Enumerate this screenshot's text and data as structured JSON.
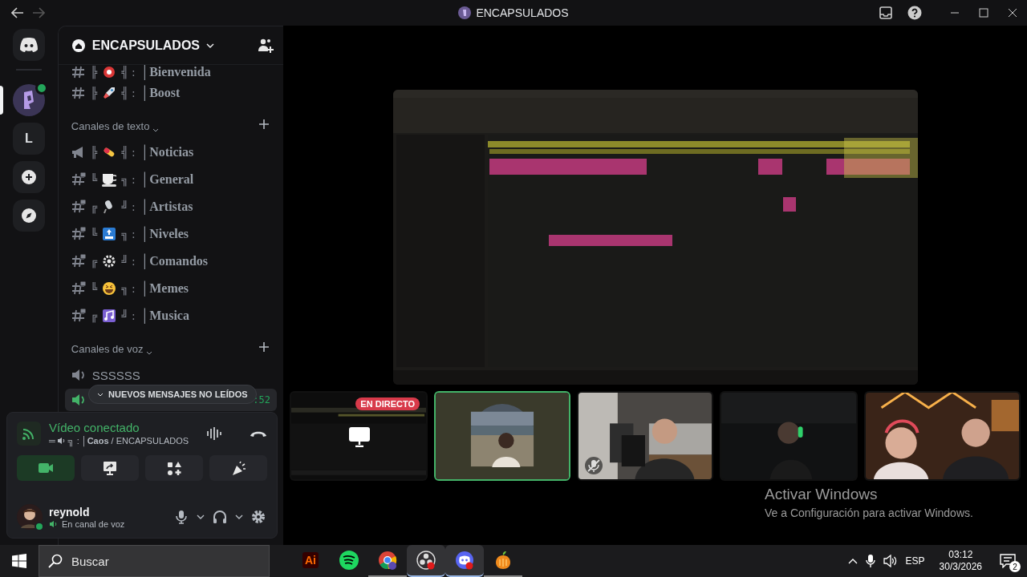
{
  "titlebar": {
    "title": "ENCAPSULADOS"
  },
  "servers": [
    {
      "kind": "home",
      "selected": false
    },
    {
      "kind": "server",
      "selected": true,
      "video": true
    },
    {
      "kind": "letter",
      "label": "L",
      "selected": false
    },
    {
      "kind": "add",
      "selected": false
    },
    {
      "kind": "discover",
      "selected": false
    }
  ],
  "guild_header": {
    "name": "ENCAPSULADOS"
  },
  "channels": [
    {
      "kind": "text",
      "locked": false,
      "deco_left": "╠",
      "deco_right": "╣ :",
      "name": "│Bienvenida"
    },
    {
      "kind": "text",
      "locked": false,
      "deco_left": "╠",
      "deco_right": "╣ :",
      "name": "│Boost"
    }
  ],
  "text_section": {
    "title": "Canales de texto",
    "channels": [
      {
        "kind": "announcement",
        "deco_left": "╠",
        "deco_right": "╣ :",
        "name": "│Noticias"
      },
      {
        "kind": "text",
        "locked": true,
        "deco_left": "╚",
        "deco_right": "╗ :",
        "name": "│General"
      },
      {
        "kind": "text",
        "locked": true,
        "deco_left": "╔",
        "deco_right": "╝ :",
        "name": "│Artistas"
      },
      {
        "kind": "text",
        "locked": true,
        "deco_left": "╚",
        "deco_right": "╗ :",
        "name": "│Niveles"
      },
      {
        "kind": "text",
        "locked": true,
        "deco_left": "╔",
        "deco_right": "╝ :",
        "name": "│Comandos"
      },
      {
        "kind": "text",
        "locked": true,
        "deco_left": "╚",
        "deco_right": "╗ :",
        "name": "│Memes"
      },
      {
        "kind": "text",
        "locked": true,
        "deco_left": "╔",
        "deco_right": "╝ :",
        "name": "│Musica"
      }
    ]
  },
  "voice_section": {
    "title": "Canales de voz",
    "channels": [
      {
        "name": "SSSSSS",
        "selected": false
      },
      {
        "timer": ":52",
        "selected": true
      }
    ]
  },
  "unread_pill": {
    "label": "NUEVOS MENSAJES NO LEÍDOS"
  },
  "voice_panel": {
    "status": "Vídeo conectado",
    "channel_deco": "═",
    "channel_text": "╗ : │**Caos** / ENCAPSULADOS",
    "actions": [
      {
        "kind": "camera",
        "on": true
      },
      {
        "kind": "screen",
        "on": false
      },
      {
        "kind": "activities",
        "on": false
      },
      {
        "kind": "soundboard",
        "on": false
      }
    ]
  },
  "user": {
    "name": "reynold",
    "status": "En canal de voz"
  },
  "tiles": [
    {
      "kind": "screen",
      "live": true,
      "badge": "EN DIRECTO",
      "selected": false,
      "muted": false
    },
    {
      "kind": "avatar",
      "live": false,
      "selected": true,
      "muted": false
    },
    {
      "kind": "room",
      "live": false,
      "selected": false,
      "muted": true
    },
    {
      "kind": "dark",
      "live": false,
      "selected": false,
      "muted": false
    },
    {
      "kind": "neon",
      "live": false,
      "selected": false,
      "muted": false
    }
  ],
  "activation": {
    "title": "Activar Windows",
    "text": "Ve a Configuración para activar Windows."
  },
  "taskbar": {
    "search": {
      "placeholder": "Buscar"
    },
    "apps": [
      {
        "kind": "illustrator",
        "label": "Ai",
        "active": false,
        "running": false
      },
      {
        "kind": "spotify",
        "active": false,
        "running": false
      },
      {
        "kind": "chrome",
        "active": false,
        "running": true
      },
      {
        "kind": "obs",
        "active": true,
        "running": true
      },
      {
        "kind": "discord",
        "active": true,
        "running": true
      },
      {
        "kind": "flstudio",
        "active": false,
        "running": true
      }
    ],
    "language": "ESP",
    "time": "03:12",
    "date": "30/3/2026",
    "notifications": "2"
  }
}
